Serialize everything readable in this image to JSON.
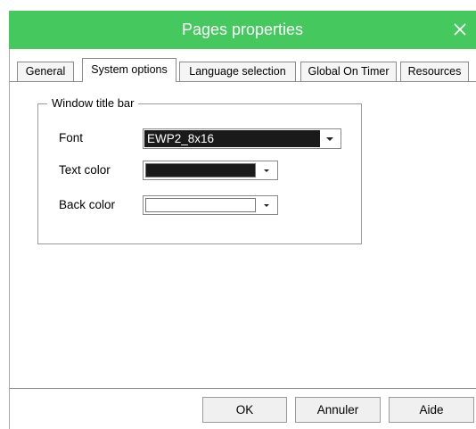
{
  "window": {
    "title": "Pages properties",
    "close_icon": "close-icon",
    "titlebar_color": "#45c85e"
  },
  "tabs": [
    {
      "label": "General",
      "active": false
    },
    {
      "label": "System options",
      "active": true
    },
    {
      "label": "Language selection",
      "active": false
    },
    {
      "label": "Global On Timer",
      "active": false
    },
    {
      "label": "Resources",
      "active": false
    }
  ],
  "group": {
    "title": "Window title bar",
    "font": {
      "label": "Font",
      "value": "EWP2_8x16"
    },
    "text_color": {
      "label": "Text color",
      "value": "#1a1a1a"
    },
    "back_color": {
      "label": "Back color",
      "value": "#ffffff"
    }
  },
  "buttons": {
    "ok": "OK",
    "cancel": "Annuler",
    "help": "Aide"
  }
}
